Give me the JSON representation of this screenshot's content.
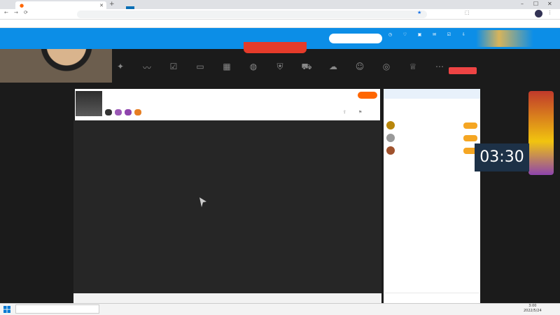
{
  "browser": {
    "tab_title": "",
    "url": "",
    "bookmarks": [
      "",
      "",
      "",
      "",
      "",
      ""
    ],
    "bookmark_right": ""
  },
  "nav": {
    "items": [
      "",
      "",
      "",
      "",
      "",
      "",
      ""
    ],
    "active_index": 1,
    "search_placeholder": "",
    "icons": [
      "",
      "",
      "",
      "",
      "",
      "",
      ""
    ]
  },
  "funcs": [
    "",
    "",
    "",
    "",
    "",
    "",
    "",
    "",
    "",
    "",
    "",
    "",
    "",
    ""
  ],
  "pc_button": "",
  "stream": {
    "title": "",
    "streamer": "",
    "fans": "",
    "viewers": "",
    "follow_label": "",
    "tags": [
      "",
      "",
      "",
      ""
    ]
  },
  "player": {
    "loading_text": ""
  },
  "chat": {
    "header": "",
    "tabs": [
      "",
      "",
      "",
      ""
    ],
    "ranks": [
      "",
      "",
      ""
    ],
    "messages": [
      {
        "prefix": "",
        "text": ""
      },
      {
        "prefix": "",
        "text": ""
      }
    ]
  },
  "overlay": {
    "timer": "03:30",
    "cam_caption": "",
    "danmaku": ""
  },
  "taskbar": {
    "search_placeholder": "",
    "time": "3:00",
    "date": "2022/5/24"
  },
  "colors": {
    "nav_blue": "#0c8ee7",
    "follow_orange": "#f60",
    "accent_red": "#e53b2a"
  }
}
